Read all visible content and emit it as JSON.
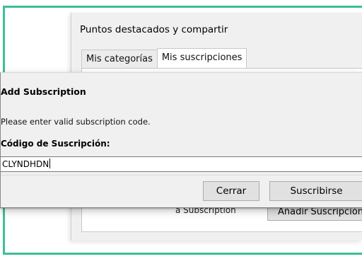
{
  "background_window": {
    "title": "Puntos destacados y compartir",
    "tabs": [
      {
        "label": "Mis categorías",
        "active": false
      },
      {
        "label": "Mis suscripciones",
        "active": true
      }
    ],
    "partial_label": "a Subscription",
    "add_button_label": "Añadir Suscripción"
  },
  "dialog": {
    "title": "Add Subscription",
    "message": "Please enter valid subscription code.",
    "code_label": "Código de Suscripción:",
    "code_value": "CLYNDHDN",
    "close_label": "Cerrar",
    "subscribe_label": "Suscribirse"
  },
  "colors": {
    "accent_border": "#3dbf98",
    "dialog_bg": "#f0f0f0"
  }
}
